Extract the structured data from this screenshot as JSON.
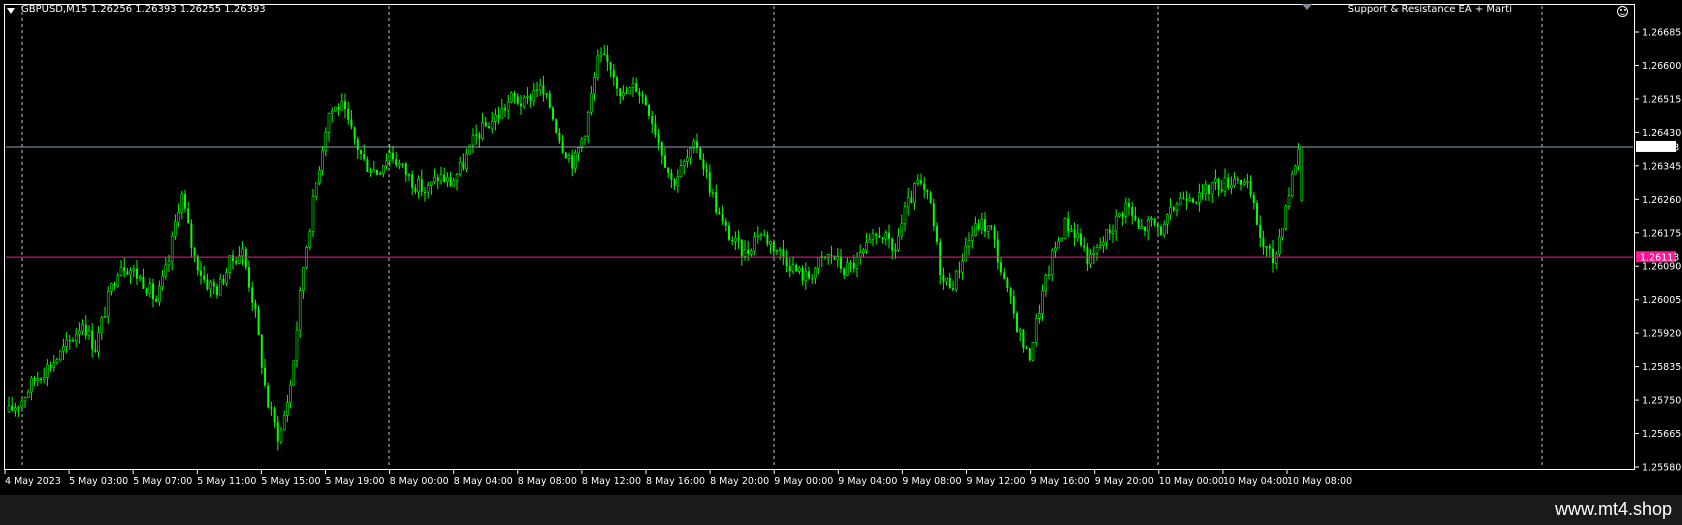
{
  "header": {
    "symbol_info": "GBPUSD,M15  1.26256 1.26393 1.26255 1.26393",
    "ea_label": "Support & Resistance EA + Marti"
  },
  "footer": {
    "watermark": "www.mt4.shop"
  },
  "colors": {
    "background": "#000000",
    "candle": "#00ff00",
    "grid": "#c0c0c0",
    "bid_line": "#8f9fb0",
    "support_line": "#ff1493",
    "axis_text": "#ffffff"
  },
  "chart_data": {
    "type": "candlestick",
    "symbol": "GBPUSD",
    "timeframe": "M15",
    "ohlc_last": {
      "open": 1.26256,
      "high": 1.26393,
      "low": 1.26255,
      "close": 1.26393
    },
    "ylim": [
      1.2558,
      1.26685
    ],
    "y_ticks": [
      {
        "value": 1.26685,
        "label": "1.26685"
      },
      {
        "value": 1.266,
        "label": "1.26600"
      },
      {
        "value": 1.26515,
        "label": "1.26515"
      },
      {
        "value": 1.2643,
        "label": "1.26430"
      },
      {
        "value": 1.26345,
        "label": "1.26345"
      },
      {
        "value": 1.2626,
        "label": "1.26260"
      },
      {
        "value": 1.26175,
        "label": "1.26175"
      },
      {
        "value": 1.2609,
        "label": "1.26090"
      },
      {
        "value": 1.26005,
        "label": "1.26005"
      },
      {
        "value": 1.2592,
        "label": "1.25920"
      },
      {
        "value": 1.25835,
        "label": "1.25835"
      },
      {
        "value": 1.2575,
        "label": "1.25750"
      },
      {
        "value": 1.25665,
        "label": "1.25665"
      },
      {
        "value": 1.2558,
        "label": "1.25580"
      }
    ],
    "x_labels": [
      "4 May 2023",
      "5 May 03:00",
      "5 May 07:00",
      "5 May 11:00",
      "5 May 15:00",
      "5 May 19:00",
      "8 May 00:00",
      "8 May 04:00",
      "8 May 08:00",
      "8 May 12:00",
      "8 May 16:00",
      "8 May 20:00",
      "9 May 00:00",
      "9 May 04:00",
      "9 May 08:00",
      "9 May 12:00",
      "9 May 16:00",
      "9 May 20:00",
      "10 May 00:00",
      "10 May 04:00",
      "10 May 08:00"
    ],
    "vertical_separators": [
      "5 May 00:00",
      "8 May 00:00",
      "9 May 00:00",
      "10 May 00:00",
      "11 May 00:00"
    ],
    "bid_price": {
      "value": 1.26393,
      "label": "1.26393"
    },
    "support_level": {
      "value": 1.26113,
      "label": "1.26113"
    },
    "price_path": [
      1.2572,
      1.2575,
      1.258,
      1.2583,
      1.2586,
      1.259,
      1.2595,
      1.2588,
      1.26,
      1.261,
      1.2608,
      1.2605,
      1.26,
      1.261,
      1.2628,
      1.2612,
      1.2605,
      1.2603,
      1.261,
      1.2613,
      1.2598,
      1.2575,
      1.2565,
      1.258,
      1.261,
      1.263,
      1.2648,
      1.265,
      1.2642,
      1.2635,
      1.2633,
      1.2638,
      1.2634,
      1.263,
      1.2628,
      1.2632,
      1.263,
      1.2635,
      1.2642,
      1.2645,
      1.2648,
      1.2652,
      1.265,
      1.2655,
      1.265,
      1.264,
      1.2635,
      1.2645,
      1.2662,
      1.266,
      1.2652,
      1.2655,
      1.265,
      1.264,
      1.263,
      1.2635,
      1.264,
      1.263,
      1.262,
      1.2615,
      1.2612,
      1.2618,
      1.2615,
      1.2612,
      1.2608,
      1.2606,
      1.261,
      1.2612,
      1.2608,
      1.261,
      1.2614,
      1.2618,
      1.2612,
      1.2623,
      1.263,
      1.2625,
      1.2605,
      1.2605,
      1.2615,
      1.262,
      1.2618,
      1.2605,
      1.2595,
      1.2585,
      1.26,
      1.2612,
      1.262,
      1.2617,
      1.261,
      1.2615,
      1.262,
      1.2625,
      1.2618,
      1.262,
      1.2618,
      1.2625,
      1.2628,
      1.2626,
      1.263,
      1.263,
      1.2632,
      1.2628,
      1.2615,
      1.261,
      1.2625,
      1.2639
    ]
  }
}
